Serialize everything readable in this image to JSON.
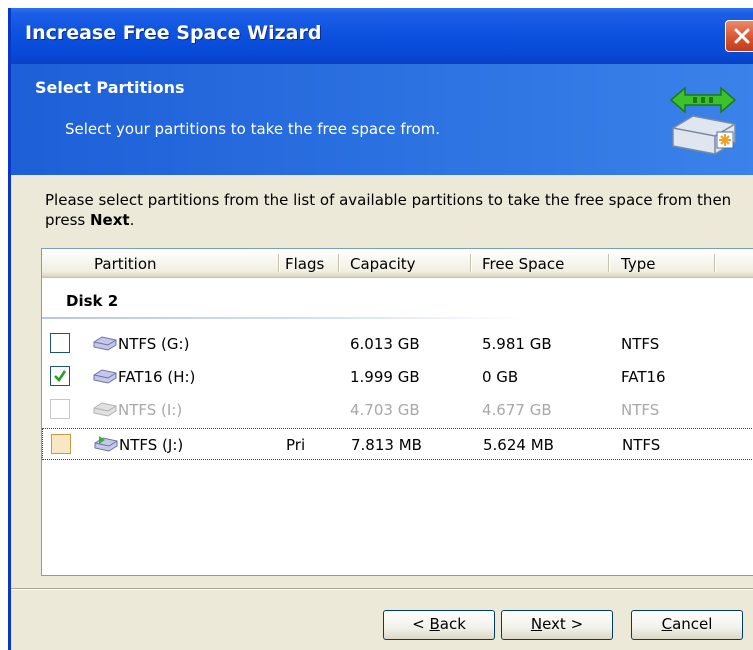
{
  "window": {
    "title": "Increase Free Space Wizard",
    "close_icon": "close-icon"
  },
  "header": {
    "title": "Select Partitions",
    "subtitle": "Select your partitions to take the free space from.",
    "icon": "disk-transfer-icon"
  },
  "instructions": {
    "text_before": "Please select partitions from the list of available partitions to take the free space from then press ",
    "bold": "Next",
    "text_after": "."
  },
  "list": {
    "columns": [
      "Partition",
      "Flags",
      "Capacity",
      "Free Space",
      "Type"
    ],
    "group": "Disk 2",
    "rows": [
      {
        "partition": "NTFS (G:)",
        "flags": "",
        "capacity": "6.013 GB",
        "free_space": "5.981 GB",
        "type": "NTFS",
        "checked": false,
        "enabled": true,
        "focused": false
      },
      {
        "partition": "FAT16 (H:)",
        "flags": "",
        "capacity": "1.999 GB",
        "free_space": "0 GB",
        "type": "FAT16",
        "checked": true,
        "enabled": true,
        "focused": false
      },
      {
        "partition": "NTFS (I:)",
        "flags": "",
        "capacity": "4.703 GB",
        "free_space": "4.677 GB",
        "type": "NTFS",
        "checked": false,
        "enabled": false,
        "focused": false
      },
      {
        "partition": "NTFS (J:)",
        "flags": "Pri",
        "capacity": "7.813 MB",
        "free_space": "5.624 MB",
        "type": "NTFS",
        "checked": false,
        "enabled": true,
        "focused": true
      }
    ]
  },
  "buttons": {
    "back": {
      "prefix": "< ",
      "accel": "B",
      "rest": "ack"
    },
    "next": {
      "accel": "N",
      "rest": "ext >"
    },
    "cancel": {
      "accel": "C",
      "rest": "ancel"
    }
  },
  "colors": {
    "titlebar": "#0748d6",
    "header": "#2e74e2",
    "face": "#ece9d8",
    "checkmark": "#21a121"
  }
}
